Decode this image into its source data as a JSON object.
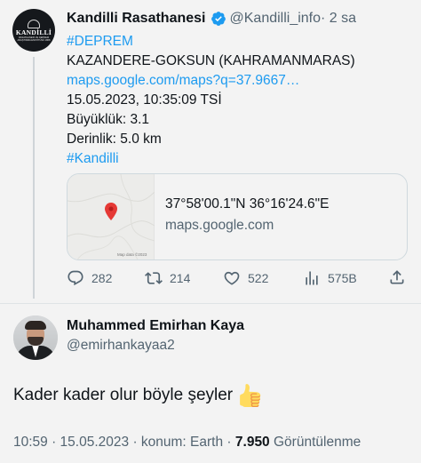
{
  "original_tweet": {
    "author": {
      "avatar_text": "KANDİLLİ",
      "avatar_subtext": "RASATHANESİ VE DEPREM ARAŞTIRMA ENSTİTÜSÜ 1868",
      "name": "Kandilli Rasathanesi",
      "handle": "@Kandilli_info",
      "time": "· 2 sa",
      "verified_icon": "verified-badge-icon"
    },
    "lines": {
      "hashtag1": "#DEPREM",
      "location": "KAZANDERE-GOKSUN (KAHRAMANMARAS)",
      "link": "maps.google.com/maps?q=37.9667…",
      "datetime": "15.05.2023, 10:35:09 TSİ",
      "magnitude": "Büyüklük: 3.1",
      "depth": "Derinlik: 5.0 km",
      "hashtag2": "#Kandilli"
    },
    "card": {
      "coordinates": "37°58'00.1\"N 36°16'24.6\"E",
      "domain": "maps.google.com",
      "map_credit": "Map data ©2023",
      "pin_icon": "map-pin-icon"
    },
    "actions": {
      "replies": "282",
      "retweets": "214",
      "likes": "522",
      "views": "575B"
    }
  },
  "reply": {
    "author": {
      "name": "Muhammed Emirhan Kaya",
      "handle": "@emirhankayaa2"
    },
    "text": "Kader kader olur böyle şeyler",
    "emoji_icon": "thumbs-up-icon",
    "meta": {
      "time_date_location": "10:59 · 15.05.2023 · konum: Earth ·",
      "views_count": "7.950",
      "views_label": "Görüntülenme"
    }
  },
  "colors": {
    "accent": "#1d9bf0",
    "secondary_text": "#536471",
    "background": "#f3f3f3"
  }
}
